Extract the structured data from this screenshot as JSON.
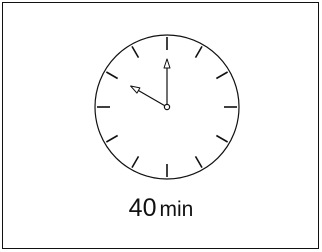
{
  "clock": {
    "hour": 10,
    "minute": 0
  },
  "caption": {
    "value": "40",
    "unit": "min"
  },
  "colors": {
    "stroke": "#111111",
    "background": "#ffffff"
  }
}
